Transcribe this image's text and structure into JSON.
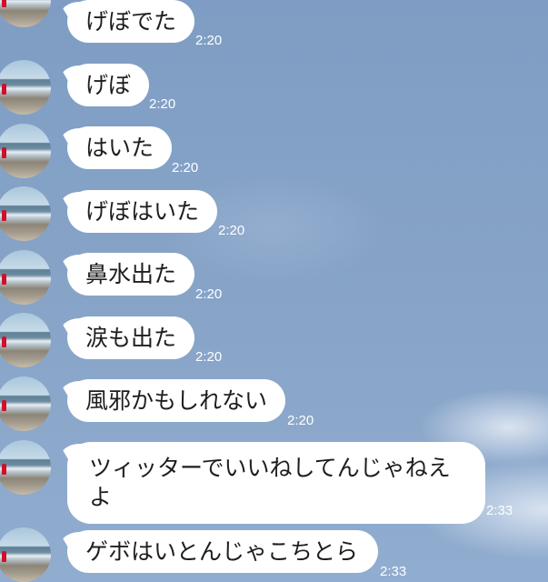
{
  "messages": [
    {
      "text": "げぼでた",
      "time": "2:20"
    },
    {
      "text": "げぼ",
      "time": "2:20"
    },
    {
      "text": "はいた",
      "time": "2:20"
    },
    {
      "text": "げぼはいた",
      "time": "2:20"
    },
    {
      "text": "鼻水出た",
      "time": "2:20"
    },
    {
      "text": "涙も出た",
      "time": "2:20"
    },
    {
      "text": "風邪かもしれない",
      "time": "2:20"
    },
    {
      "text": "ツィッターでいいねしてんじゃねえよ",
      "time": "2:33"
    },
    {
      "text": "ゲボはいとんじゃこちとら",
      "time": "2:33"
    }
  ]
}
